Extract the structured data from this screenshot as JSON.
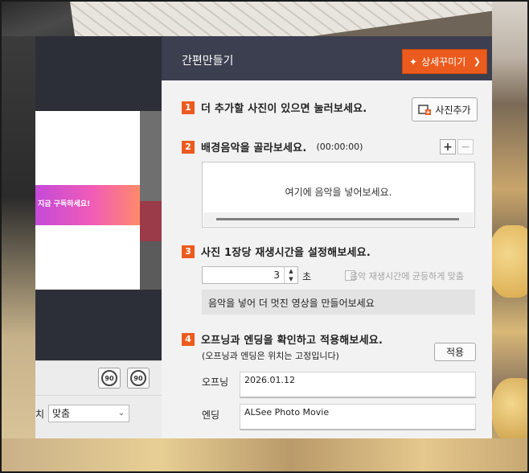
{
  "colors": {
    "accent": "#ec5b1e",
    "header_bg": "#3c3f4f",
    "panel_bg": "#f2f2f2"
  },
  "preview": {
    "overlay_text": "지금 구독하세요!",
    "rotate_left_icon": "rotate-left-90-icon",
    "rotate_left_label": "90",
    "rotate_right_icon": "rotate-right-90-icon",
    "rotate_right_label": "90",
    "fit_label": "치",
    "fit_value": "맞춤"
  },
  "panel": {
    "title": "간편만들기",
    "detail_button": "상세꾸미기"
  },
  "step1": {
    "num": "1",
    "text": "더 추가할 사진이 있으면 눌러보세요.",
    "add_photo_button": "사진추가"
  },
  "step2": {
    "num": "2",
    "text": "배경음악을 골라보세요.",
    "duration": "(00:00:00)",
    "add_button": "+",
    "remove_button": "−",
    "drop_hint": "여기에 음악을 넣어보세요."
  },
  "step3": {
    "num": "3",
    "text": "사진 1장당 재생시간을 설정해보세요.",
    "seconds_value": "3",
    "unit": "초",
    "sync_label": "음악 재생시간에 균등하게 맞춤",
    "info": "음악을 넣어 더 멋진 영상을 만들어보세요"
  },
  "step4": {
    "num": "4",
    "text": "오프닝과 엔딩을 확인하고 적용해보세요.",
    "note": "(오프닝과 엔딩은 위치는 고정입니다)",
    "apply_button": "적용",
    "opening_label": "오프닝",
    "opening_value": "2026.01.12",
    "ending_label": "엔딩",
    "ending_value": "ALSee Photo Movie"
  }
}
